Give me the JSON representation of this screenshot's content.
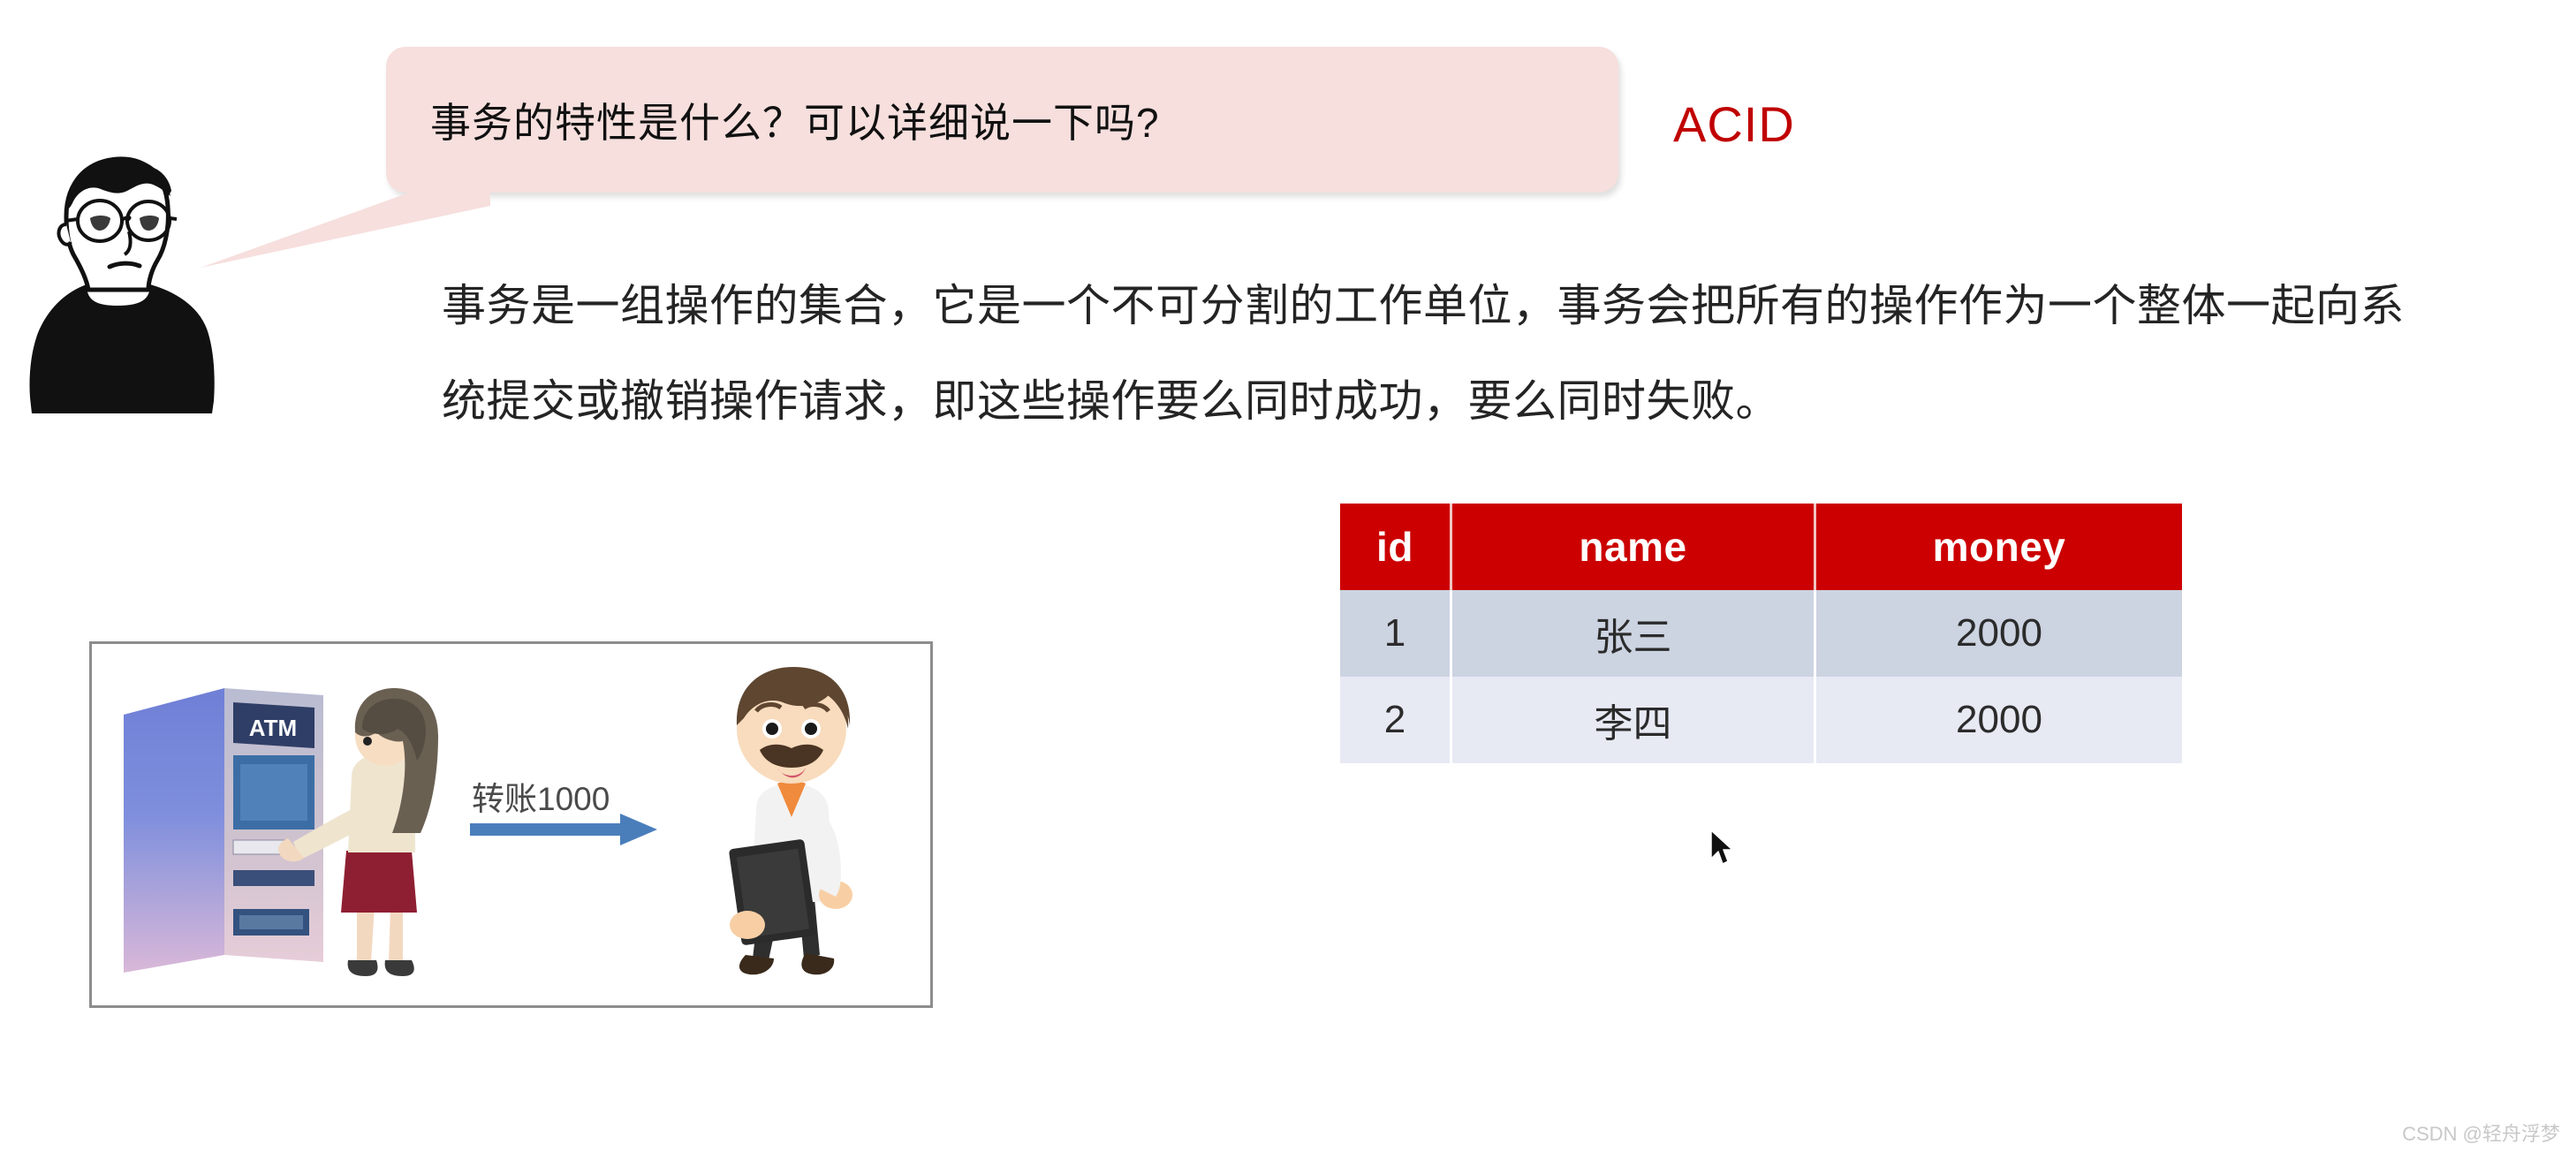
{
  "avatar": {
    "name": "person-with-glasses-avatar",
    "description": "line-art man with glasses wearing black turtleneck"
  },
  "bubble": {
    "question": "事务的特性是什么？可以详细说一下吗?",
    "background_color": "#f6dfdd"
  },
  "acid": {
    "label": "ACID",
    "color": "#c00000"
  },
  "paragraph": {
    "line1": "事务是一组操作的集合，它是一个不可分割的工作单位，事务会把所有的操作作为一个整体一起向系",
    "line2": "统提交或撤销操作请求，即这些操作要么同时成功，要么同时失败。"
  },
  "illustration": {
    "atm_label": "ATM",
    "transfer_label": "转账1000",
    "arrow_color": "#4a7ebb",
    "border_color": "#8d8d8d"
  },
  "table": {
    "header_color": "#cc0000",
    "columns": [
      "id",
      "name",
      "money"
    ],
    "rows": [
      {
        "id": "1",
        "name": "张三",
        "money": "2000"
      },
      {
        "id": "2",
        "name": "李四",
        "money": "2000"
      }
    ]
  },
  "cursor": {
    "icon": "mouse-pointer-icon"
  },
  "watermark": {
    "text": "CSDN @轻舟浮梦"
  }
}
